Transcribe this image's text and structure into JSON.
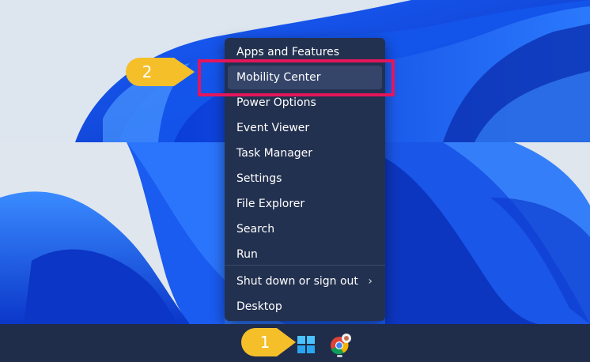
{
  "context_menu": {
    "items": [
      {
        "label": "Apps and Features"
      },
      {
        "label": "Mobility Center"
      },
      {
        "label": "Power Options"
      },
      {
        "label": "Event Viewer"
      },
      {
        "label": "Task Manager"
      },
      {
        "label": "Settings"
      },
      {
        "label": "File Explorer"
      },
      {
        "label": "Search"
      },
      {
        "label": "Run"
      },
      {
        "label": "Shut down or sign out"
      },
      {
        "label": "Desktop"
      }
    ],
    "submenu_chevron": "›",
    "highlighted_item": "Mobility Center"
  },
  "callouts": [
    {
      "number": "1",
      "color": "#f5bf2a",
      "target": "start-button"
    },
    {
      "number": "2",
      "color": "#f5bf2a",
      "target": "Mobility Center"
    }
  ],
  "highlight_color": "#e3165b",
  "taskbar": {
    "icons": [
      "windows-start-icon",
      "chrome-icon"
    ],
    "background": "#1f2c4a"
  },
  "menu_colors": {
    "background": "#233150",
    "hover": "#35456a",
    "text": "#ffffff"
  }
}
